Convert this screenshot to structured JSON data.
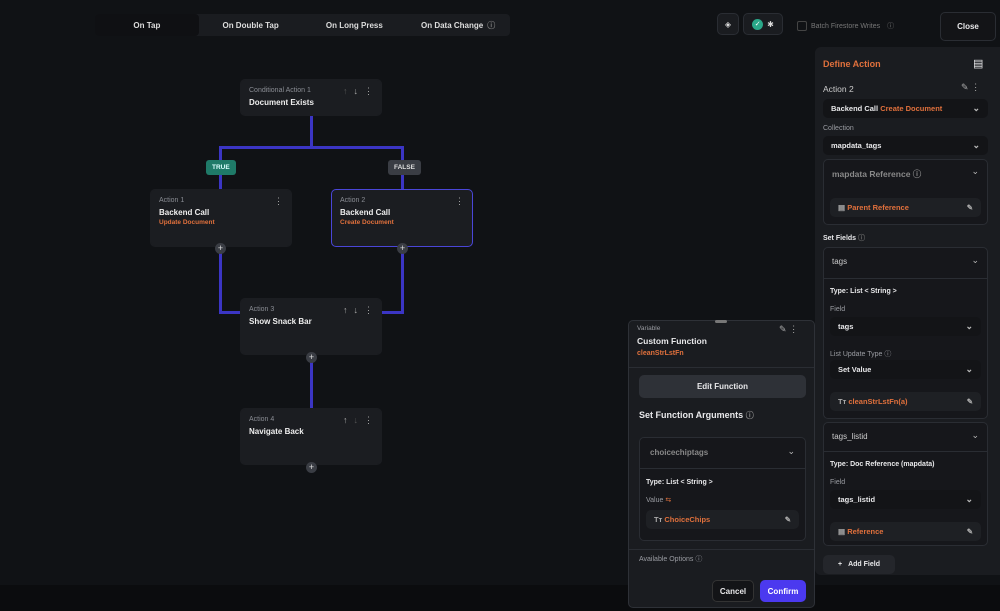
{
  "tabs": [
    "On Tap",
    "On Double Tap",
    "On Long Press",
    "On Data Change"
  ],
  "toolbar": {
    "batch_label": "Batch Firestore Writes",
    "close": "Close"
  },
  "flow": {
    "conditional": {
      "label": "Conditional Action 1",
      "title": "Document Exists"
    },
    "true_label": "TRUE",
    "false_label": "FALSE",
    "actions": [
      {
        "label": "Action 1",
        "title": "Backend Call",
        "sub": "Update Document"
      },
      {
        "label": "Action 2",
        "title": "Backend Call",
        "sub": "Create Document"
      },
      {
        "label": "Action 3",
        "title": "Show Snack Bar"
      },
      {
        "label": "Action 4",
        "title": "Navigate Back"
      }
    ]
  },
  "panel": {
    "title": "Define Action",
    "action_name": "Action 2",
    "action_type": "Backend Call",
    "action_subtype": "Create Document",
    "collection_label": "Collection",
    "collection": "mapdata_tags",
    "ref_label": "mapdata Reference",
    "ref_value": "Parent Reference",
    "set_fields_label": "Set Fields",
    "fields": [
      {
        "name": "tags",
        "type": "Type: List < String >",
        "field_label": "Field",
        "field": "tags",
        "update_label": "List Update Type",
        "update": "Set Value",
        "value": "cleanStrLstFn(a)"
      },
      {
        "name": "tags_listid",
        "type": "Type: Doc Reference (mapdata)",
        "field_label": "Field",
        "field": "tags_listid",
        "value": "Reference"
      }
    ],
    "add_field": "Add Field"
  },
  "popup": {
    "kind": "Variable",
    "title": "Custom Function",
    "fn": "cleanStrLstFn",
    "edit": "Edit Function",
    "args_title": "Set Function Arguments",
    "arg": "choicechiptags",
    "arg_type": "Type: List < String >",
    "value_label": "Value",
    "value": "ChoiceChips",
    "available": "Available Options",
    "cancel": "Cancel",
    "confirm": "Confirm"
  }
}
